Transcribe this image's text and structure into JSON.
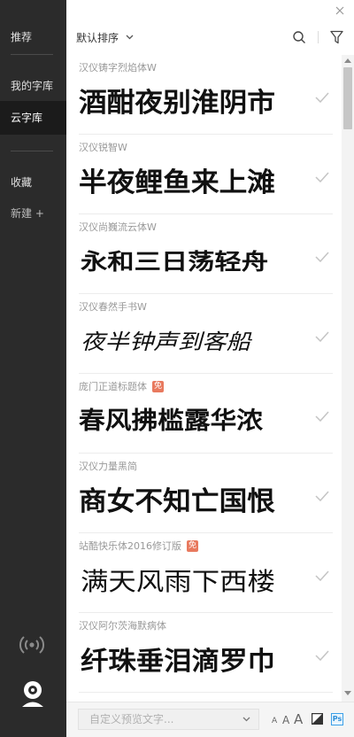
{
  "sidebar": {
    "recommend": "推荐",
    "my_fonts": "我的字库",
    "cloud_fonts": "云字库",
    "favorites": "收藏",
    "new": "新建 +"
  },
  "topbar": {
    "sort_label": "默认排序"
  },
  "fonts": [
    {
      "name": "汉仪铸字烈焰体W",
      "preview": "酒酣夜别淮阴市",
      "free": false
    },
    {
      "name": "汉仪锐智W",
      "preview": "半夜鲤鱼来上滩",
      "free": false
    },
    {
      "name": "汉仪尚巍流云体W",
      "preview": "永和三日荡轻舟",
      "free": false
    },
    {
      "name": "汉仪春然手书W",
      "preview": "夜半钟声到客船",
      "free": false
    },
    {
      "name": "庞门正道标题体",
      "preview": "春风拂槛露华浓",
      "free": true,
      "badge": "免"
    },
    {
      "name": "汉仪力量黑简",
      "preview": "商女不知亡国恨",
      "free": false
    },
    {
      "name": "站酷快乐体2016修订版",
      "preview": "满天风雨下西楼",
      "free": true,
      "badge": "免"
    },
    {
      "name": "汉仪阿尔茨海默病体",
      "preview": "纤珠垂泪滴罗巾",
      "free": false
    }
  ],
  "bottombar": {
    "preview_placeholder": "自定义预览文字...",
    "size_small": "A",
    "size_mid": "A",
    "size_large": "A",
    "ps_label": "Ps"
  }
}
